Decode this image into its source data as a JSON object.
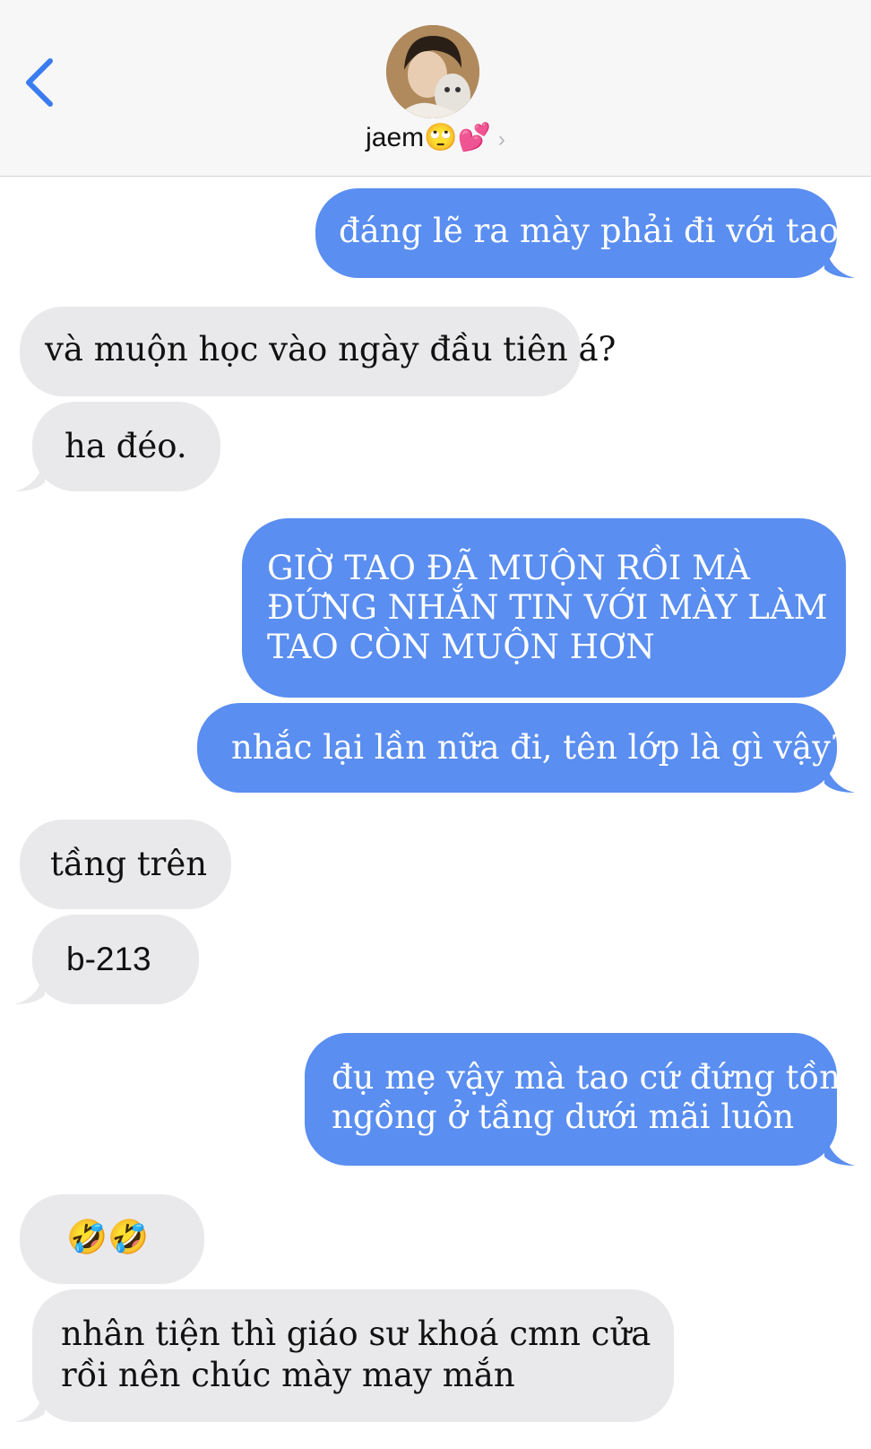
{
  "header": {
    "contact_name": "jaem🙄💕",
    "chevron": "›",
    "back_icon": "chevron-left-icon",
    "colors": {
      "accent": "#3a7cf0",
      "header_bg": "#f7f7f7"
    }
  },
  "colors": {
    "outgoing": "#5a8ef0",
    "incoming": "#e9e9eb"
  },
  "messages": [
    {
      "direction": "outgoing",
      "text": "đáng lẽ ra mày phải đi với tao"
    },
    {
      "direction": "incoming",
      "text": "và muộn học vào ngày đầu tiên á?"
    },
    {
      "direction": "incoming",
      "text": "ha đéo."
    },
    {
      "direction": "outgoing",
      "lines": [
        "GIỜ TAO ĐÃ MUỘN RỒI MÀ",
        "ĐỨNG NHẮN TIN VỚI MÀY LÀM",
        "TAO CÒN MUỘN HƠN"
      ]
    },
    {
      "direction": "outgoing",
      "text": "nhắc lại lần nữa đi, tên lớp là gì vậy?"
    },
    {
      "direction": "incoming",
      "text": "tầng trên"
    },
    {
      "direction": "incoming",
      "text": "b-213"
    },
    {
      "direction": "outgoing",
      "lines": [
        "đụ mẹ vậy mà tao cứ đứng tồng",
        "ngồng ở tầng dưới mãi luôn"
      ]
    },
    {
      "direction": "incoming",
      "text": "🤣🤣"
    },
    {
      "direction": "incoming",
      "lines": [
        "nhân tiện thì giáo sư khoá cmn cửa",
        "rồi nên chúc mày may mắn"
      ]
    }
  ]
}
